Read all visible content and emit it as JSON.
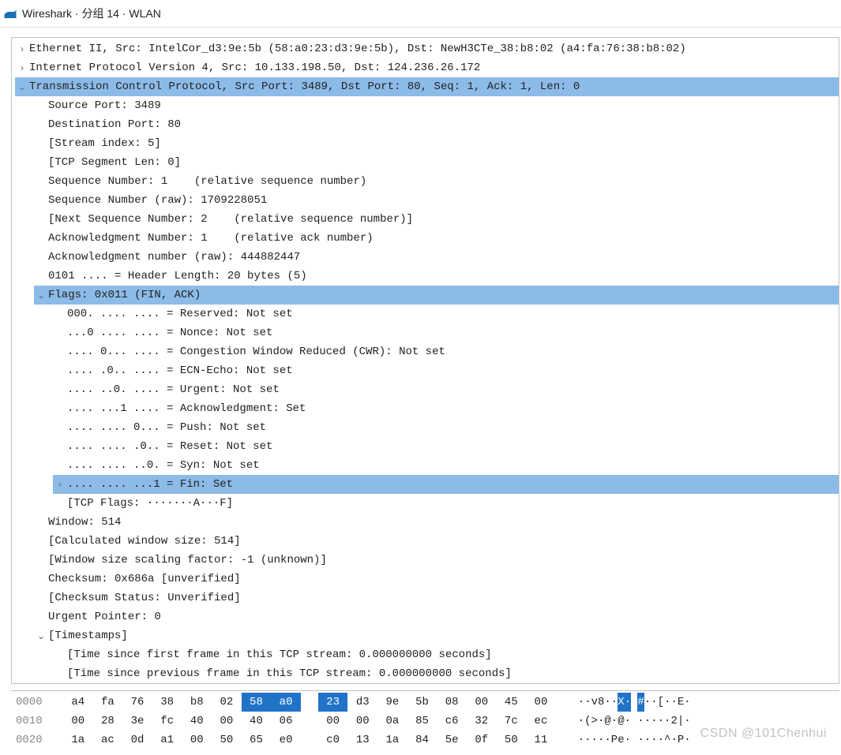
{
  "window": {
    "title": "Wireshark · 分组 14 · WLAN"
  },
  "details": {
    "rows": [
      {
        "id": "eth",
        "indent": 0,
        "toggle": "collapsed",
        "highlight": false,
        "text": "Ethernet II, Src: IntelCor_d3:9e:5b (58:a0:23:d3:9e:5b), Dst: NewH3CTe_38:b8:02 (a4:fa:76:38:b8:02)"
      },
      {
        "id": "ip",
        "indent": 0,
        "toggle": "collapsed",
        "highlight": false,
        "text": "Internet Protocol Version 4, Src: 10.133.198.50, Dst: 124.236.26.172"
      },
      {
        "id": "tcp",
        "indent": 0,
        "toggle": "expanded",
        "highlight": true,
        "text": "Transmission Control Protocol, Src Port: 3489, Dst Port: 80, Seq: 1, Ack: 1, Len: 0"
      },
      {
        "id": "srcport",
        "indent": 1,
        "toggle": "none",
        "highlight": false,
        "text": "Source Port: 3489"
      },
      {
        "id": "dstport",
        "indent": 1,
        "toggle": "none",
        "highlight": false,
        "text": "Destination Port: 80"
      },
      {
        "id": "streamidx",
        "indent": 1,
        "toggle": "none",
        "highlight": false,
        "text": "[Stream index: 5]"
      },
      {
        "id": "seglen",
        "indent": 1,
        "toggle": "none",
        "highlight": false,
        "text": "[TCP Segment Len: 0]"
      },
      {
        "id": "seqnum",
        "indent": 1,
        "toggle": "none",
        "highlight": false,
        "text": "Sequence Number: 1    (relative sequence number)"
      },
      {
        "id": "seqraw",
        "indent": 1,
        "toggle": "none",
        "highlight": false,
        "text": "Sequence Number (raw): 1709228051"
      },
      {
        "id": "nextseq",
        "indent": 1,
        "toggle": "none",
        "highlight": false,
        "text": "[Next Sequence Number: 2    (relative sequence number)]"
      },
      {
        "id": "acknum",
        "indent": 1,
        "toggle": "none",
        "highlight": false,
        "text": "Acknowledgment Number: 1    (relative ack number)"
      },
      {
        "id": "ackraw",
        "indent": 1,
        "toggle": "none",
        "highlight": false,
        "text": "Acknowledgment number (raw): 444882447"
      },
      {
        "id": "hdrlen",
        "indent": 1,
        "toggle": "none",
        "highlight": false,
        "text": "0101 .... = Header Length: 20 bytes (5)"
      },
      {
        "id": "flags",
        "indent": 1,
        "toggle": "expanded",
        "highlight": true,
        "text": "Flags: 0x011 (FIN, ACK)"
      },
      {
        "id": "flg-res",
        "indent": 2,
        "toggle": "none",
        "highlight": false,
        "text": "000. .... .... = Reserved: Not set"
      },
      {
        "id": "flg-nonce",
        "indent": 2,
        "toggle": "none",
        "highlight": false,
        "text": "...0 .... .... = Nonce: Not set"
      },
      {
        "id": "flg-cwr",
        "indent": 2,
        "toggle": "none",
        "highlight": false,
        "text": ".... 0... .... = Congestion Window Reduced (CWR): Not set"
      },
      {
        "id": "flg-ecn",
        "indent": 2,
        "toggle": "none",
        "highlight": false,
        "text": ".... .0.. .... = ECN-Echo: Not set"
      },
      {
        "id": "flg-urg",
        "indent": 2,
        "toggle": "none",
        "highlight": false,
        "text": ".... ..0. .... = Urgent: Not set"
      },
      {
        "id": "flg-ack",
        "indent": 2,
        "toggle": "none",
        "highlight": false,
        "text": ".... ...1 .... = Acknowledgment: Set"
      },
      {
        "id": "flg-psh",
        "indent": 2,
        "toggle": "none",
        "highlight": false,
        "text": ".... .... 0... = Push: Not set"
      },
      {
        "id": "flg-rst",
        "indent": 2,
        "toggle": "none",
        "highlight": false,
        "text": ".... .... .0.. = Reset: Not set"
      },
      {
        "id": "flg-syn",
        "indent": 2,
        "toggle": "none",
        "highlight": false,
        "text": ".... .... ..0. = Syn: Not set"
      },
      {
        "id": "flg-fin",
        "indent": 2,
        "toggle": "collapsed",
        "highlight": true,
        "text": ".... .... ...1 = Fin: Set"
      },
      {
        "id": "tcpflags",
        "indent": 2,
        "toggle": "none",
        "highlight": false,
        "text": "[TCP Flags: ·······A···F]"
      },
      {
        "id": "window",
        "indent": 1,
        "toggle": "none",
        "highlight": false,
        "text": "Window: 514"
      },
      {
        "id": "calcwin",
        "indent": 1,
        "toggle": "none",
        "highlight": false,
        "text": "[Calculated window size: 514]"
      },
      {
        "id": "winscale",
        "indent": 1,
        "toggle": "none",
        "highlight": false,
        "text": "[Window size scaling factor: -1 (unknown)]"
      },
      {
        "id": "checksum",
        "indent": 1,
        "toggle": "none",
        "highlight": false,
        "text": "Checksum: 0x686a [unverified]"
      },
      {
        "id": "chkstat",
        "indent": 1,
        "toggle": "none",
        "highlight": false,
        "text": "[Checksum Status: Unverified]"
      },
      {
        "id": "urgptr",
        "indent": 1,
        "toggle": "none",
        "highlight": false,
        "text": "Urgent Pointer: 0"
      },
      {
        "id": "timestamps",
        "indent": 1,
        "toggle": "expanded",
        "highlight": false,
        "text": "[Timestamps]"
      },
      {
        "id": "ts-first",
        "indent": 2,
        "toggle": "none",
        "highlight": false,
        "text": "[Time since first frame in this TCP stream: 0.000000000 seconds]"
      },
      {
        "id": "ts-prev",
        "indent": 2,
        "toggle": "none",
        "highlight": false,
        "text": "[Time since previous frame in this TCP stream: 0.000000000 seconds]"
      }
    ]
  },
  "hex": {
    "rows": [
      {
        "offset": "0000",
        "bytes": [
          "a4",
          "fa",
          "76",
          "38",
          "b8",
          "02",
          "58",
          "a0",
          "23",
          "d3",
          "9e",
          "5b",
          "08",
          "00",
          "45",
          "00"
        ],
        "byte_hl": [
          false,
          false,
          false,
          false,
          false,
          false,
          true,
          true,
          true,
          false,
          false,
          false,
          false,
          false,
          false,
          false
        ],
        "ascii": [
          "·",
          "·",
          "v",
          "8",
          "·",
          "·",
          "X",
          "·",
          "#",
          "·",
          "·",
          "[",
          "·",
          "·",
          "E",
          "·"
        ],
        "ascii_hl": [
          false,
          false,
          false,
          false,
          false,
          false,
          true,
          true,
          true,
          false,
          false,
          false,
          false,
          false,
          false,
          false
        ]
      },
      {
        "offset": "0010",
        "bytes": [
          "00",
          "28",
          "3e",
          "fc",
          "40",
          "00",
          "40",
          "06",
          "00",
          "00",
          "0a",
          "85",
          "c6",
          "32",
          "7c",
          "ec"
        ],
        "byte_hl": [
          false,
          false,
          false,
          false,
          false,
          false,
          false,
          false,
          false,
          false,
          false,
          false,
          false,
          false,
          false,
          false
        ],
        "ascii": [
          "·",
          "(",
          ">",
          "·",
          "@",
          "·",
          "@",
          "·",
          "·",
          "·",
          "·",
          "·",
          "·",
          "2",
          "|",
          "·"
        ],
        "ascii_hl": [
          false,
          false,
          false,
          false,
          false,
          false,
          false,
          false,
          false,
          false,
          false,
          false,
          false,
          false,
          false,
          false
        ]
      },
      {
        "offset": "0020",
        "bytes": [
          "1a",
          "ac",
          "0d",
          "a1",
          "00",
          "50",
          "65",
          "e0",
          "c0",
          "13",
          "1a",
          "84",
          "5e",
          "0f",
          "50",
          "11"
        ],
        "byte_hl": [
          false,
          false,
          false,
          false,
          false,
          false,
          false,
          false,
          false,
          false,
          false,
          false,
          false,
          false,
          false,
          false
        ],
        "ascii": [
          "·",
          "·",
          "·",
          "·",
          "·",
          "P",
          "e",
          "·",
          "·",
          "·",
          "·",
          "·",
          "^",
          "·",
          "P",
          "·"
        ],
        "ascii_hl": [
          false,
          false,
          false,
          false,
          false,
          false,
          false,
          false,
          false,
          false,
          false,
          false,
          false,
          false,
          false,
          false
        ]
      }
    ]
  },
  "watermark": "CSDN @101Chenhui"
}
